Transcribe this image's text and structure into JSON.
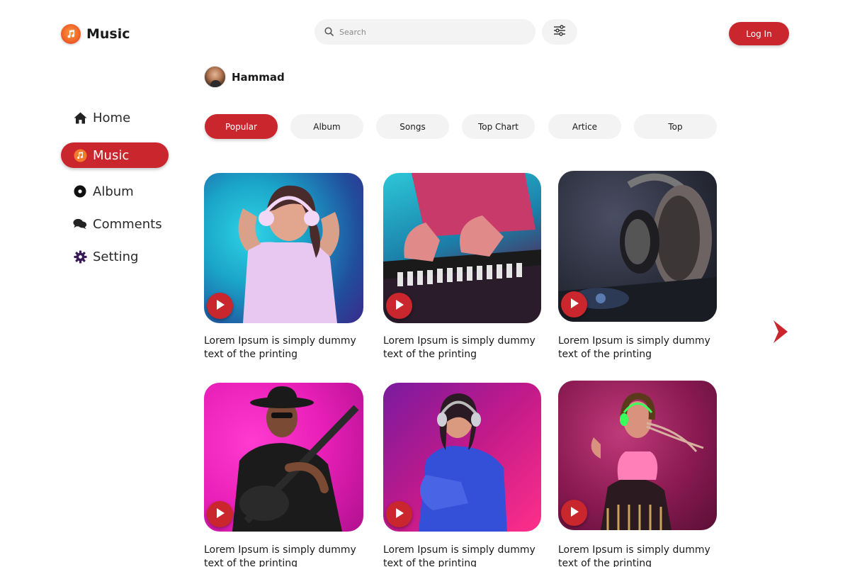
{
  "app": {
    "name": "Music"
  },
  "search": {
    "placeholder": "Search"
  },
  "header": {
    "login_label": "Log In"
  },
  "sidebar": {
    "items": [
      {
        "label": "Home",
        "icon": "home-icon",
        "active": false
      },
      {
        "label": "Music",
        "icon": "music-icon",
        "active": true
      },
      {
        "label": "Album",
        "icon": "disc-icon",
        "active": false
      },
      {
        "label": "Comments",
        "icon": "comments-icon",
        "active": false
      },
      {
        "label": "Setting",
        "icon": "gear-icon",
        "active": false
      }
    ]
  },
  "user": {
    "name": "Hammad"
  },
  "tabs": [
    {
      "label": "Popular",
      "active": true
    },
    {
      "label": "Album",
      "active": false
    },
    {
      "label": "Songs",
      "active": false
    },
    {
      "label": "Top Chart",
      "active": false
    },
    {
      "label": "Artice",
      "active": false
    },
    {
      "label": "Top",
      "active": false
    }
  ],
  "cards": [
    {
      "caption": "Lorem Ipsum is simply dummy text of the printing",
      "image": "woman-headphones-photo"
    },
    {
      "caption": "Lorem Ipsum is simply dummy text of the printing",
      "image": "dj-keyboard-photo"
    },
    {
      "caption": "Lorem Ipsum is simply dummy text of the printing",
      "image": "headphones-turntable-photo"
    },
    {
      "caption": "Lorem Ipsum is simply dummy text of the printing",
      "image": "guitarist-photo"
    },
    {
      "caption": "Lorem Ipsum is simply dummy text of the printing",
      "image": "woman-headphones-neon-photo"
    },
    {
      "caption": "Lorem Ipsum is simply dummy text of the printing",
      "image": "woman-braids-photo"
    }
  ],
  "colors": {
    "accent": "#c9262d",
    "pill_bg": "#f3f3f3",
    "text": "#1a1a1a"
  }
}
